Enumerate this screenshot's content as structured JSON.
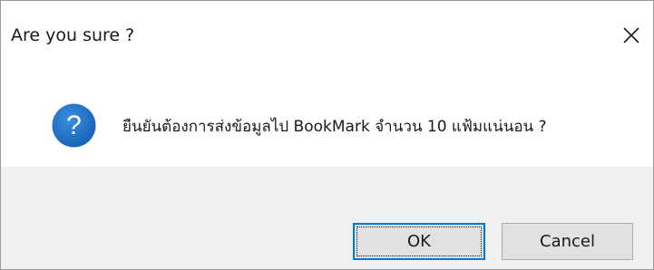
{
  "dialog": {
    "title": "Are you sure ?",
    "close_icon": "close-icon",
    "icon": "question-icon",
    "icon_glyph": "?",
    "icon_color": "#1f6fc5",
    "message": "ยืนยันต้องการส่งข้อมูลไป BookMark จำนวน 10 แฟ้มแน่นอน ?",
    "buttons": {
      "ok_label": "OK",
      "cancel_label": "Cancel"
    },
    "focus_color": "#0078d7",
    "footer_color": "#f0f0f0"
  }
}
